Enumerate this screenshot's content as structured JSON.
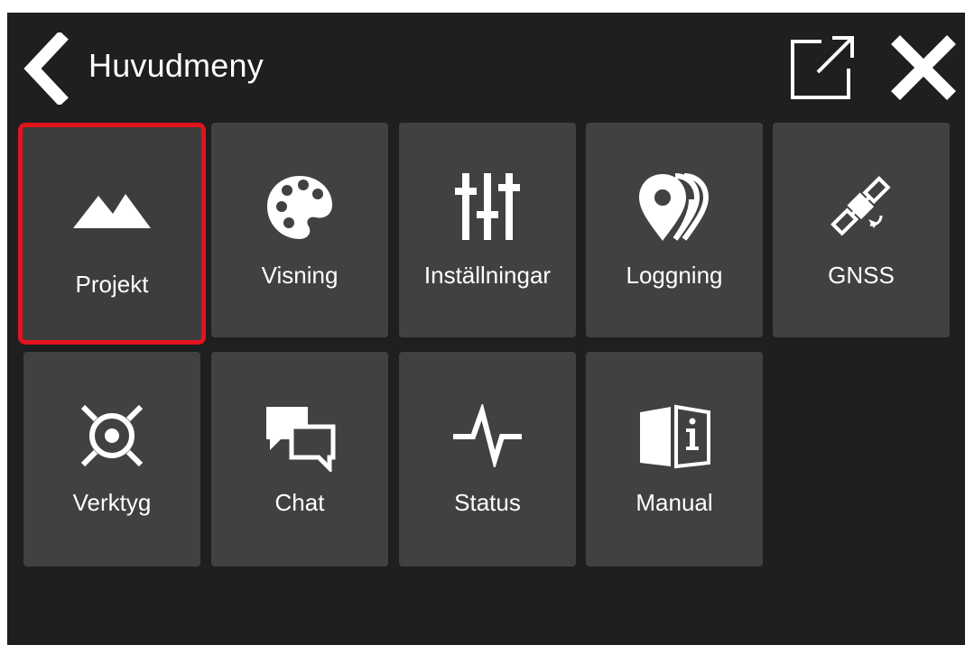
{
  "header": {
    "title": "Huvudmeny"
  },
  "colors": {
    "background": "#1d1f20",
    "tile": "#414141",
    "selection": "#e0141c",
    "text": "#ffffff"
  },
  "menu": {
    "items": [
      {
        "label": "Projekt",
        "icon": "mountains-icon",
        "selected": true
      },
      {
        "label": "Visning",
        "icon": "palette-icon"
      },
      {
        "label": "Inställningar",
        "icon": "sliders-icon"
      },
      {
        "label": "Loggning",
        "icon": "location-pins-icon"
      },
      {
        "label": "GNSS",
        "icon": "satellite-icon"
      },
      {
        "label": "Verktyg",
        "icon": "tools-target-icon"
      },
      {
        "label": "Chat",
        "icon": "chat-bubbles-icon"
      },
      {
        "label": "Status",
        "icon": "pulse-icon"
      },
      {
        "label": "Manual",
        "icon": "manual-book-icon"
      }
    ]
  }
}
